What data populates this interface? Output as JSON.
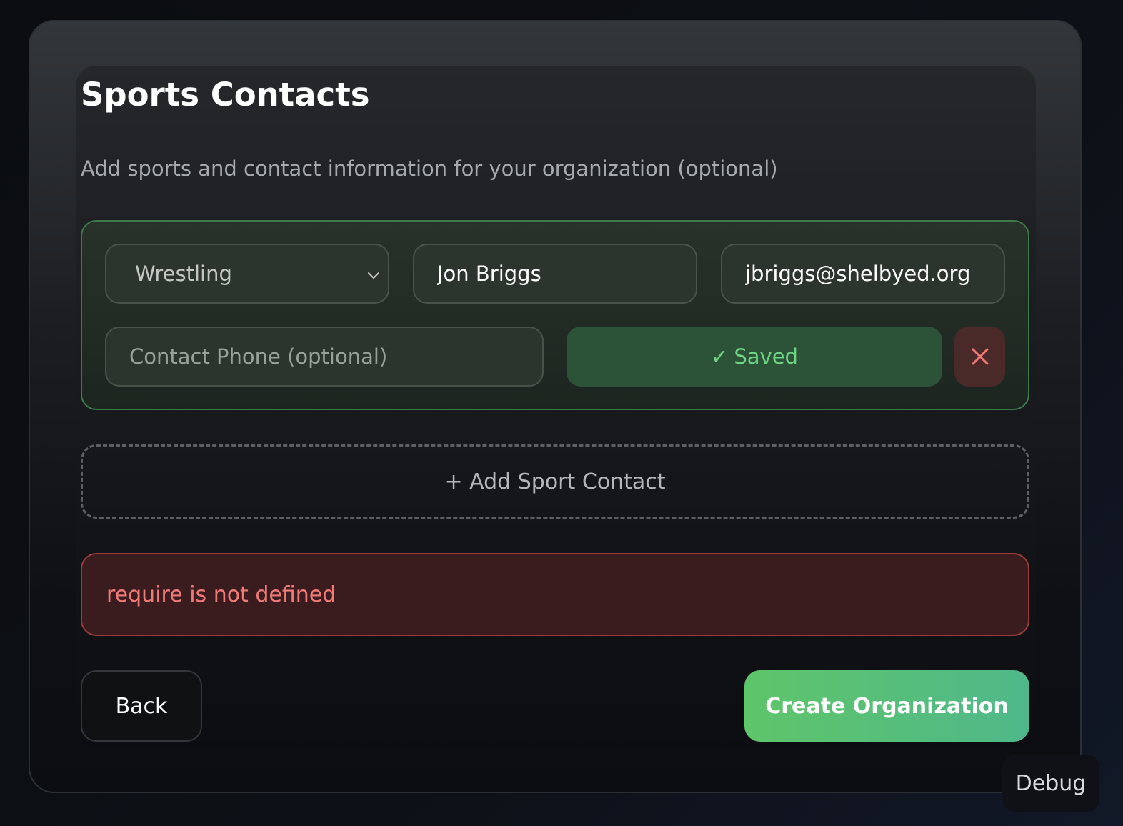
{
  "page": {
    "title": "Sports Contacts",
    "subtitle": "Add sports and contact information for your organization (optional)"
  },
  "contact": {
    "sport": "Wrestling",
    "name": "Jon Briggs",
    "email": "jbriggs@shelbyed.org",
    "phone": "",
    "phone_placeholder": "Contact Phone (optional)",
    "saved_check": "✓",
    "saved_label": "Saved"
  },
  "actions": {
    "add_contact_label": "+ Add Sport Contact",
    "back_label": "Back",
    "create_label": "Create Organization",
    "debug_label": "Debug"
  },
  "error": {
    "message": "require is not defined"
  },
  "icons": {
    "select_chevron": "chevron-down-icon",
    "remove": "close-icon"
  },
  "colors": {
    "accent_green": "#5fc56a",
    "saved_text": "#6fd685",
    "error_text": "#f07a78",
    "error_border": "#9a3b3b"
  }
}
